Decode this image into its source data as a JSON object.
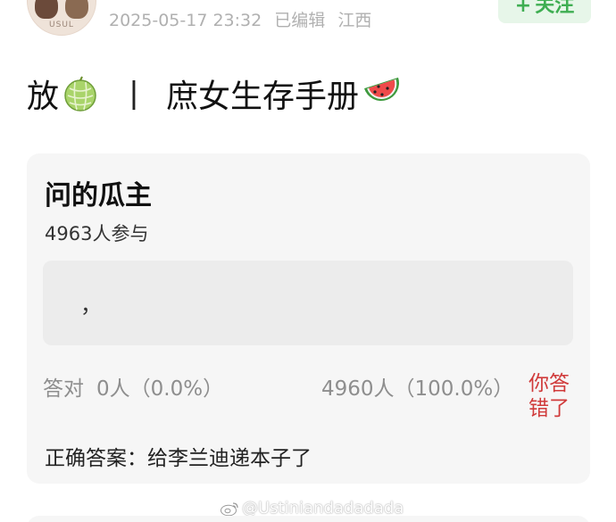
{
  "post": {
    "avatar_label": "USUL",
    "timestamp": "2025-05-17 23:32",
    "edited": "已编辑",
    "location": "江西",
    "follow_label": "关注",
    "follow_plus": "+"
  },
  "title": {
    "part1": "放",
    "separator": "丨",
    "part2": "庶女生存手册",
    "icons": [
      "melon-icon",
      "watermelon-icon"
    ]
  },
  "quiz": {
    "title": "问的瓜主",
    "participants": "4963人参与",
    "option_text": "，",
    "correct_label": "答对",
    "correct_value": "0人（0.0%）",
    "option_stat": "4960人（100.0%）",
    "wrong_badge": "你答错了",
    "answer": "正确答案：给李兰迪递本子了"
  },
  "watermark": {
    "text": "@Ustiniandadadada",
    "icon": "weibo-icon"
  },
  "colors": {
    "follow_bg": "#e7f6e9",
    "follow_text": "#3fae52",
    "card_bg": "#f6f6f6",
    "wrong": "#d03a3a",
    "meta": "#b0b0b0"
  }
}
